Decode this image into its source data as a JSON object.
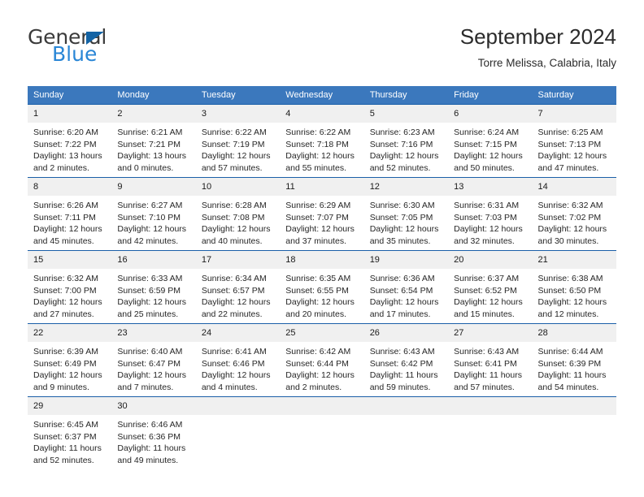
{
  "brand": {
    "name_top": "General",
    "name_bottom": "Blue",
    "triangle_color": "#1464a5",
    "blue_color": "#2986d6"
  },
  "header": {
    "title": "September 2024",
    "subtitle": "Torre Melissa, Calabria, Italy"
  },
  "theme": {
    "header_bg": "#3b78bd",
    "header_text": "#ffffff",
    "daynum_bg": "#f0f0f0",
    "row_divider": "#1a5fa8"
  },
  "weekday_headers": [
    "Sunday",
    "Monday",
    "Tuesday",
    "Wednesday",
    "Thursday",
    "Friday",
    "Saturday"
  ],
  "weeks": [
    [
      {
        "day": "1",
        "sunrise": "Sunrise: 6:20 AM",
        "sunset": "Sunset: 7:22 PM",
        "daylight_line1": "Daylight: 13 hours",
        "daylight_line2": "and 2 minutes."
      },
      {
        "day": "2",
        "sunrise": "Sunrise: 6:21 AM",
        "sunset": "Sunset: 7:21 PM",
        "daylight_line1": "Daylight: 13 hours",
        "daylight_line2": "and 0 minutes."
      },
      {
        "day": "3",
        "sunrise": "Sunrise: 6:22 AM",
        "sunset": "Sunset: 7:19 PM",
        "daylight_line1": "Daylight: 12 hours",
        "daylight_line2": "and 57 minutes."
      },
      {
        "day": "4",
        "sunrise": "Sunrise: 6:22 AM",
        "sunset": "Sunset: 7:18 PM",
        "daylight_line1": "Daylight: 12 hours",
        "daylight_line2": "and 55 minutes."
      },
      {
        "day": "5",
        "sunrise": "Sunrise: 6:23 AM",
        "sunset": "Sunset: 7:16 PM",
        "daylight_line1": "Daylight: 12 hours",
        "daylight_line2": "and 52 minutes."
      },
      {
        "day": "6",
        "sunrise": "Sunrise: 6:24 AM",
        "sunset": "Sunset: 7:15 PM",
        "daylight_line1": "Daylight: 12 hours",
        "daylight_line2": "and 50 minutes."
      },
      {
        "day": "7",
        "sunrise": "Sunrise: 6:25 AM",
        "sunset": "Sunset: 7:13 PM",
        "daylight_line1": "Daylight: 12 hours",
        "daylight_line2": "and 47 minutes."
      }
    ],
    [
      {
        "day": "8",
        "sunrise": "Sunrise: 6:26 AM",
        "sunset": "Sunset: 7:11 PM",
        "daylight_line1": "Daylight: 12 hours",
        "daylight_line2": "and 45 minutes."
      },
      {
        "day": "9",
        "sunrise": "Sunrise: 6:27 AM",
        "sunset": "Sunset: 7:10 PM",
        "daylight_line1": "Daylight: 12 hours",
        "daylight_line2": "and 42 minutes."
      },
      {
        "day": "10",
        "sunrise": "Sunrise: 6:28 AM",
        "sunset": "Sunset: 7:08 PM",
        "daylight_line1": "Daylight: 12 hours",
        "daylight_line2": "and 40 minutes."
      },
      {
        "day": "11",
        "sunrise": "Sunrise: 6:29 AM",
        "sunset": "Sunset: 7:07 PM",
        "daylight_line1": "Daylight: 12 hours",
        "daylight_line2": "and 37 minutes."
      },
      {
        "day": "12",
        "sunrise": "Sunrise: 6:30 AM",
        "sunset": "Sunset: 7:05 PM",
        "daylight_line1": "Daylight: 12 hours",
        "daylight_line2": "and 35 minutes."
      },
      {
        "day": "13",
        "sunrise": "Sunrise: 6:31 AM",
        "sunset": "Sunset: 7:03 PM",
        "daylight_line1": "Daylight: 12 hours",
        "daylight_line2": "and 32 minutes."
      },
      {
        "day": "14",
        "sunrise": "Sunrise: 6:32 AM",
        "sunset": "Sunset: 7:02 PM",
        "daylight_line1": "Daylight: 12 hours",
        "daylight_line2": "and 30 minutes."
      }
    ],
    [
      {
        "day": "15",
        "sunrise": "Sunrise: 6:32 AM",
        "sunset": "Sunset: 7:00 PM",
        "daylight_line1": "Daylight: 12 hours",
        "daylight_line2": "and 27 minutes."
      },
      {
        "day": "16",
        "sunrise": "Sunrise: 6:33 AM",
        "sunset": "Sunset: 6:59 PM",
        "daylight_line1": "Daylight: 12 hours",
        "daylight_line2": "and 25 minutes."
      },
      {
        "day": "17",
        "sunrise": "Sunrise: 6:34 AM",
        "sunset": "Sunset: 6:57 PM",
        "daylight_line1": "Daylight: 12 hours",
        "daylight_line2": "and 22 minutes."
      },
      {
        "day": "18",
        "sunrise": "Sunrise: 6:35 AM",
        "sunset": "Sunset: 6:55 PM",
        "daylight_line1": "Daylight: 12 hours",
        "daylight_line2": "and 20 minutes."
      },
      {
        "day": "19",
        "sunrise": "Sunrise: 6:36 AM",
        "sunset": "Sunset: 6:54 PM",
        "daylight_line1": "Daylight: 12 hours",
        "daylight_line2": "and 17 minutes."
      },
      {
        "day": "20",
        "sunrise": "Sunrise: 6:37 AM",
        "sunset": "Sunset: 6:52 PM",
        "daylight_line1": "Daylight: 12 hours",
        "daylight_line2": "and 15 minutes."
      },
      {
        "day": "21",
        "sunrise": "Sunrise: 6:38 AM",
        "sunset": "Sunset: 6:50 PM",
        "daylight_line1": "Daylight: 12 hours",
        "daylight_line2": "and 12 minutes."
      }
    ],
    [
      {
        "day": "22",
        "sunrise": "Sunrise: 6:39 AM",
        "sunset": "Sunset: 6:49 PM",
        "daylight_line1": "Daylight: 12 hours",
        "daylight_line2": "and 9 minutes."
      },
      {
        "day": "23",
        "sunrise": "Sunrise: 6:40 AM",
        "sunset": "Sunset: 6:47 PM",
        "daylight_line1": "Daylight: 12 hours",
        "daylight_line2": "and 7 minutes."
      },
      {
        "day": "24",
        "sunrise": "Sunrise: 6:41 AM",
        "sunset": "Sunset: 6:46 PM",
        "daylight_line1": "Daylight: 12 hours",
        "daylight_line2": "and 4 minutes."
      },
      {
        "day": "25",
        "sunrise": "Sunrise: 6:42 AM",
        "sunset": "Sunset: 6:44 PM",
        "daylight_line1": "Daylight: 12 hours",
        "daylight_line2": "and 2 minutes."
      },
      {
        "day": "26",
        "sunrise": "Sunrise: 6:43 AM",
        "sunset": "Sunset: 6:42 PM",
        "daylight_line1": "Daylight: 11 hours",
        "daylight_line2": "and 59 minutes."
      },
      {
        "day": "27",
        "sunrise": "Sunrise: 6:43 AM",
        "sunset": "Sunset: 6:41 PM",
        "daylight_line1": "Daylight: 11 hours",
        "daylight_line2": "and 57 minutes."
      },
      {
        "day": "28",
        "sunrise": "Sunrise: 6:44 AM",
        "sunset": "Sunset: 6:39 PM",
        "daylight_line1": "Daylight: 11 hours",
        "daylight_line2": "and 54 minutes."
      }
    ],
    [
      {
        "day": "29",
        "sunrise": "Sunrise: 6:45 AM",
        "sunset": "Sunset: 6:37 PM",
        "daylight_line1": "Daylight: 11 hours",
        "daylight_line2": "and 52 minutes."
      },
      {
        "day": "30",
        "sunrise": "Sunrise: 6:46 AM",
        "sunset": "Sunset: 6:36 PM",
        "daylight_line1": "Daylight: 11 hours",
        "daylight_line2": "and 49 minutes."
      },
      {
        "day": "",
        "sunrise": "",
        "sunset": "",
        "daylight_line1": "",
        "daylight_line2": ""
      },
      {
        "day": "",
        "sunrise": "",
        "sunset": "",
        "daylight_line1": "",
        "daylight_line2": ""
      },
      {
        "day": "",
        "sunrise": "",
        "sunset": "",
        "daylight_line1": "",
        "daylight_line2": ""
      },
      {
        "day": "",
        "sunrise": "",
        "sunset": "",
        "daylight_line1": "",
        "daylight_line2": ""
      },
      {
        "day": "",
        "sunrise": "",
        "sunset": "",
        "daylight_line1": "",
        "daylight_line2": ""
      }
    ]
  ]
}
